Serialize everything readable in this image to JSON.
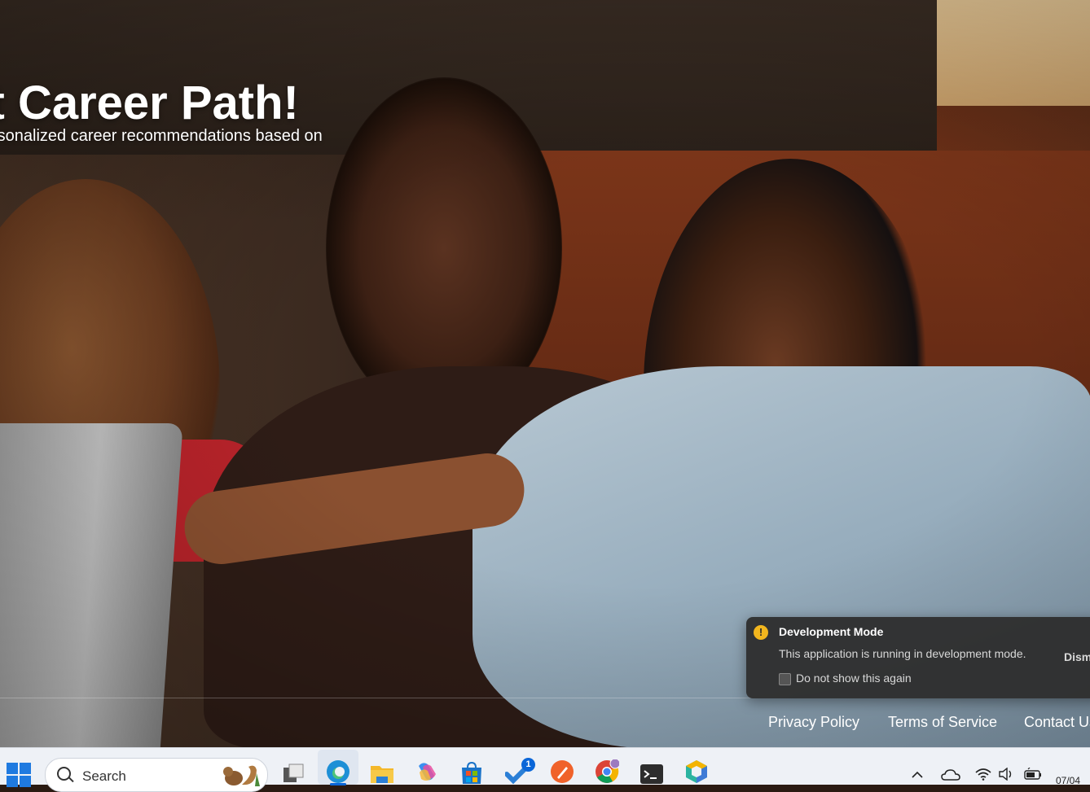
{
  "hero": {
    "title": "ect Career Path!",
    "subtitle": "rsonalized career recommendations based on"
  },
  "footer": {
    "links": [
      {
        "label": "Privacy Policy"
      },
      {
        "label": "Terms of Service"
      },
      {
        "label": "Contact Us"
      }
    ]
  },
  "toast": {
    "title": "Development Mode",
    "message": "This application is running in development mode.",
    "dismiss_label": "Dism",
    "checkbox_label": "Do not show this again",
    "checkbox_checked": false,
    "icon": "warning-icon",
    "icon_glyph": "!",
    "accent_color": "#f2b61e"
  },
  "taskbar": {
    "search_placeholder": "Search",
    "apps": [
      {
        "name": "windows-start-icon"
      },
      {
        "name": "task-view-icon"
      },
      {
        "name": "edge-icon"
      },
      {
        "name": "file-explorer-icon"
      },
      {
        "name": "copilot-icon"
      },
      {
        "name": "microsoft-store-icon"
      },
      {
        "name": "todo-icon",
        "badge": "1"
      },
      {
        "name": "pen-app-icon"
      },
      {
        "name": "chrome-icon"
      },
      {
        "name": "terminal-icon"
      },
      {
        "name": "hexagon-app-icon"
      }
    ],
    "clock_text": "07/04"
  }
}
